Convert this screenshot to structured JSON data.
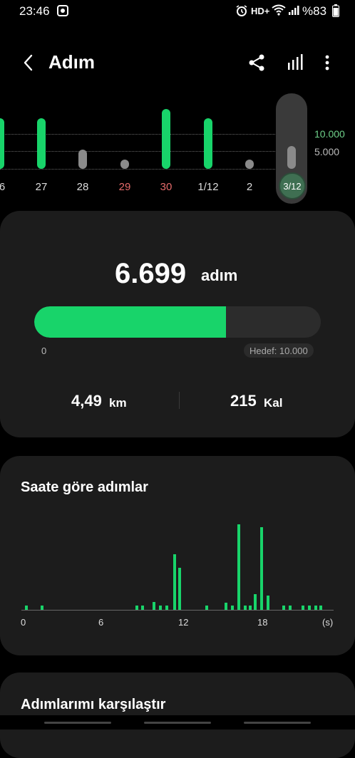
{
  "status": {
    "time": "23:46",
    "network": "HD+",
    "battery": "%83"
  },
  "header": {
    "title": "Adım"
  },
  "daily_chart": {
    "scale_high": "10.000",
    "scale_low": "5.000",
    "days": [
      {
        "label": "6",
        "level": "high",
        "color": "#18d46a",
        "highlight": false
      },
      {
        "label": "27",
        "level": "high",
        "color": "#18d46a",
        "highlight": false
      },
      {
        "label": "28",
        "level": "mid",
        "color": "#8a8a8a",
        "highlight": false
      },
      {
        "label": "29",
        "level": "low",
        "color": "#8a8a8a",
        "highlight": true
      },
      {
        "label": "30",
        "level": "max",
        "color": "#18d46a",
        "highlight": true
      },
      {
        "label": "1/12",
        "level": "high",
        "color": "#18d46a",
        "highlight": false
      },
      {
        "label": "2",
        "level": "low",
        "color": "#8a8a8a",
        "highlight": false
      }
    ],
    "selected_label": "3/12"
  },
  "steps": {
    "value": "6.699",
    "unit": "adım",
    "progress": 0.67,
    "min_label": "0",
    "goal_label": "Hedef: 10.000",
    "distance_value": "4,49",
    "distance_unit": "km",
    "calories_value": "215",
    "calories_unit": "Kal"
  },
  "hourly": {
    "title": "Saate göre adımlar",
    "ticks": [
      "0",
      "6",
      "12",
      "18",
      "(s)"
    ],
    "bars": [
      0.4,
      1.6,
      9.0,
      9.4,
      10.3,
      10.8,
      11.3,
      11.9,
      12.3,
      14.4,
      15.9,
      16.4,
      16.9,
      17.4,
      17.8,
      18.2,
      18.7,
      19.2,
      20.4,
      20.9,
      21.9,
      22.4,
      22.9,
      23.3
    ],
    "bar_levels": [
      0.05,
      0.05,
      0.05,
      0.05,
      0.09,
      0.05,
      0.05,
      0.65,
      0.49,
      0.05,
      0.08,
      0.05,
      1.0,
      0.05,
      0.05,
      0.18,
      0.97,
      0.17,
      0.05,
      0.05,
      0.05,
      0.05,
      0.05,
      0.05
    ]
  },
  "compare": {
    "title": "Adımlarımı karşılaştır"
  }
}
